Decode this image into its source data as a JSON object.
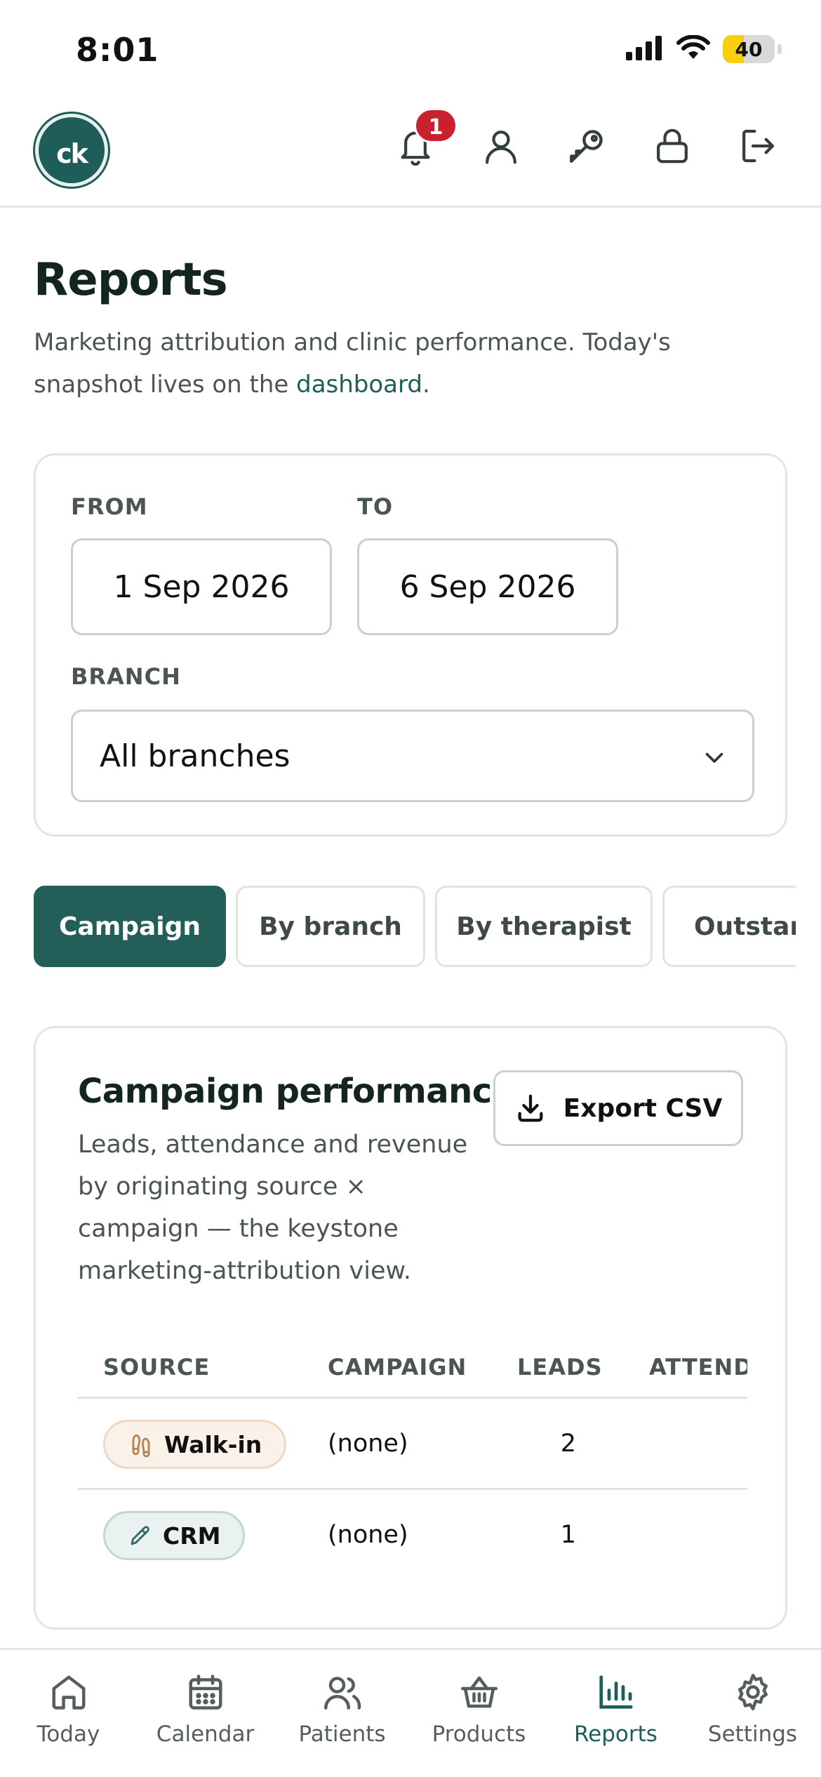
{
  "status_bar": {
    "time": "8:01",
    "battery": "40",
    "battery_level": 0.4
  },
  "header": {
    "logo_text": "ck",
    "notification_count": "1"
  },
  "page": {
    "title": "Reports",
    "subtitle_prefix": "Marketing attribution and clinic performance. Today's snapshot lives on the ",
    "subtitle_link": "dashboard",
    "subtitle_suffix": "."
  },
  "filters": {
    "from_label": "FROM",
    "from_value": "1 Sep 2026",
    "to_label": "TO",
    "to_value": "6 Sep 2026",
    "branch_label": "BRANCH",
    "branch_value": "All branches"
  },
  "tabs": [
    {
      "label": "Campaign",
      "active": true
    },
    {
      "label": "By branch",
      "active": false
    },
    {
      "label": "By therapist",
      "active": false
    },
    {
      "label": "Outstan",
      "active": false
    }
  ],
  "campaign": {
    "title": "Campaign performance",
    "description": "Leads, attendance and revenue by originating source × campaign — the keystone marketing-attribution view.",
    "export_label": "Export CSV",
    "columns": [
      "SOURCE",
      "CAMPAIGN",
      "LEADS",
      "ATTEND"
    ],
    "rows": [
      {
        "source": "Walk-in",
        "source_icon": "footprints-icon",
        "campaign": "(none)",
        "leads": "2"
      },
      {
        "source": "CRM",
        "source_icon": "pencil-icon",
        "campaign": "(none)",
        "leads": "1"
      }
    ]
  },
  "bottom_nav": [
    {
      "label": "Today",
      "icon": "home-icon",
      "active": false
    },
    {
      "label": "Calendar",
      "icon": "calendar-icon",
      "active": false
    },
    {
      "label": "Patients",
      "icon": "users-icon",
      "active": false
    },
    {
      "label": "Products",
      "icon": "basket-icon",
      "active": false
    },
    {
      "label": "Reports",
      "icon": "bar-chart-icon",
      "active": true
    },
    {
      "label": "Settings",
      "icon": "gear-icon",
      "active": false
    }
  ],
  "colors": {
    "primary": "#245e59",
    "badge": "#c8202d",
    "battery": "#f7cf0f"
  }
}
